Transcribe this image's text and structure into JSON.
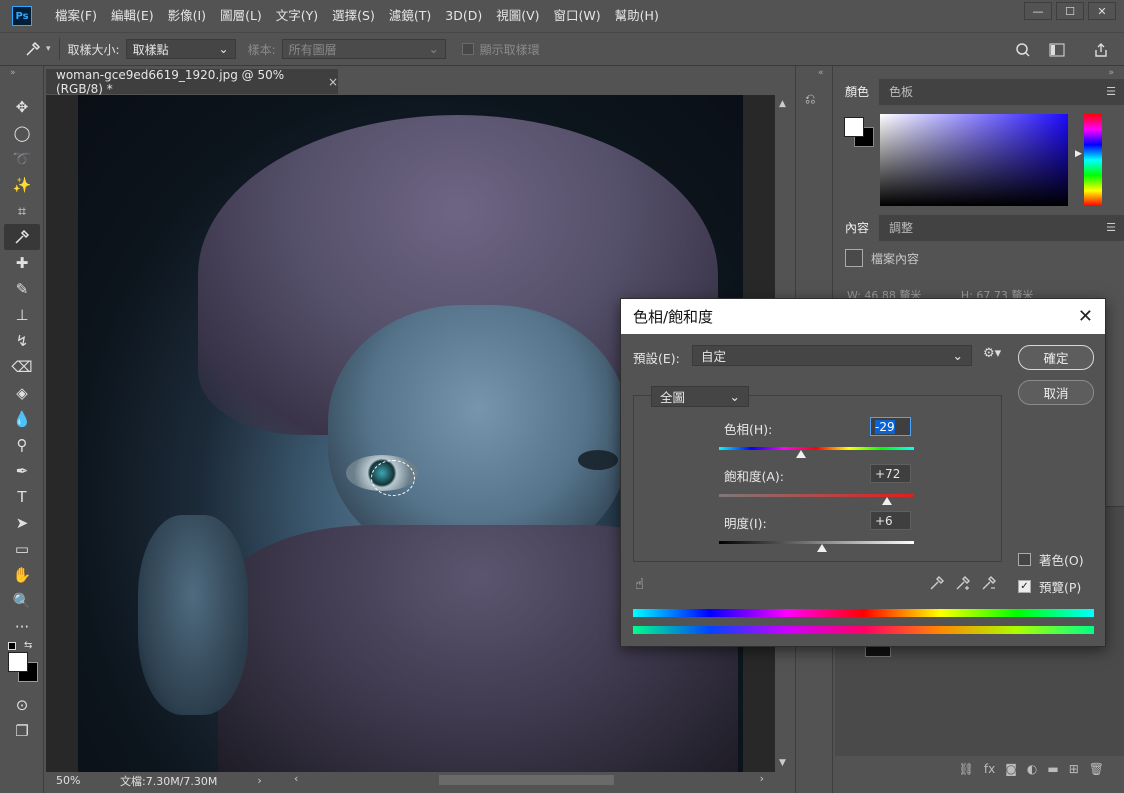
{
  "menubar": {
    "logo": "Ps",
    "items": [
      "檔案(F)",
      "編輯(E)",
      "影像(I)",
      "圖層(L)",
      "文字(Y)",
      "選擇(S)",
      "濾鏡(T)",
      "3D(D)",
      "視圖(V)",
      "窗口(W)",
      "幫助(H)"
    ],
    "window_controls": [
      "—",
      "☐",
      "✕"
    ]
  },
  "options_bar": {
    "sample_size_label": "取樣大小:",
    "sample_size_value": "取樣點",
    "sample_label": "樣本:",
    "sample_value": "所有圖層",
    "show_ring_label": "顯示取樣環"
  },
  "document": {
    "tab_title": "woman-gce9ed6619_1920.jpg @ 50%(RGB/8) *",
    "close": "×"
  },
  "status": {
    "zoom": "50%",
    "doc_size": "文檔:7.30M/7.30M"
  },
  "panels": {
    "color_tabs": [
      "顏色",
      "色板"
    ],
    "props_tabs": [
      "內容",
      "調整"
    ],
    "props_title": "檔案內容",
    "props_w": "W:  46.88  釐米",
    "props_h": "H:  67.73  釐米"
  },
  "colors": {
    "foreground": "#ffffff",
    "background": "#000000",
    "accent": "#1d0aff"
  },
  "dialog": {
    "title": "色相/飽和度",
    "preset_label": "預設(E):",
    "preset_value": "自定",
    "channel_value": "全圖",
    "ok_label": "確定",
    "cancel_label": "取消",
    "hue_label": "色相(H):",
    "hue_value": "-29",
    "hue_level": -29,
    "saturation_label": "飽和度(A):",
    "saturation_value": "+72",
    "saturation_level": 72,
    "lightness_label": "明度(I):",
    "lightness_value": "+6",
    "lightness_level": 6,
    "colorize_label": "著色(O)",
    "preview_label": "預覽(P)",
    "colorize_checked": false,
    "preview_checked": true
  },
  "icons": {
    "eyedropper": "eyedropper-icon",
    "search": "search-icon",
    "share": "share-icon",
    "gear": "gear-icon",
    "hand": "hand-icon"
  }
}
